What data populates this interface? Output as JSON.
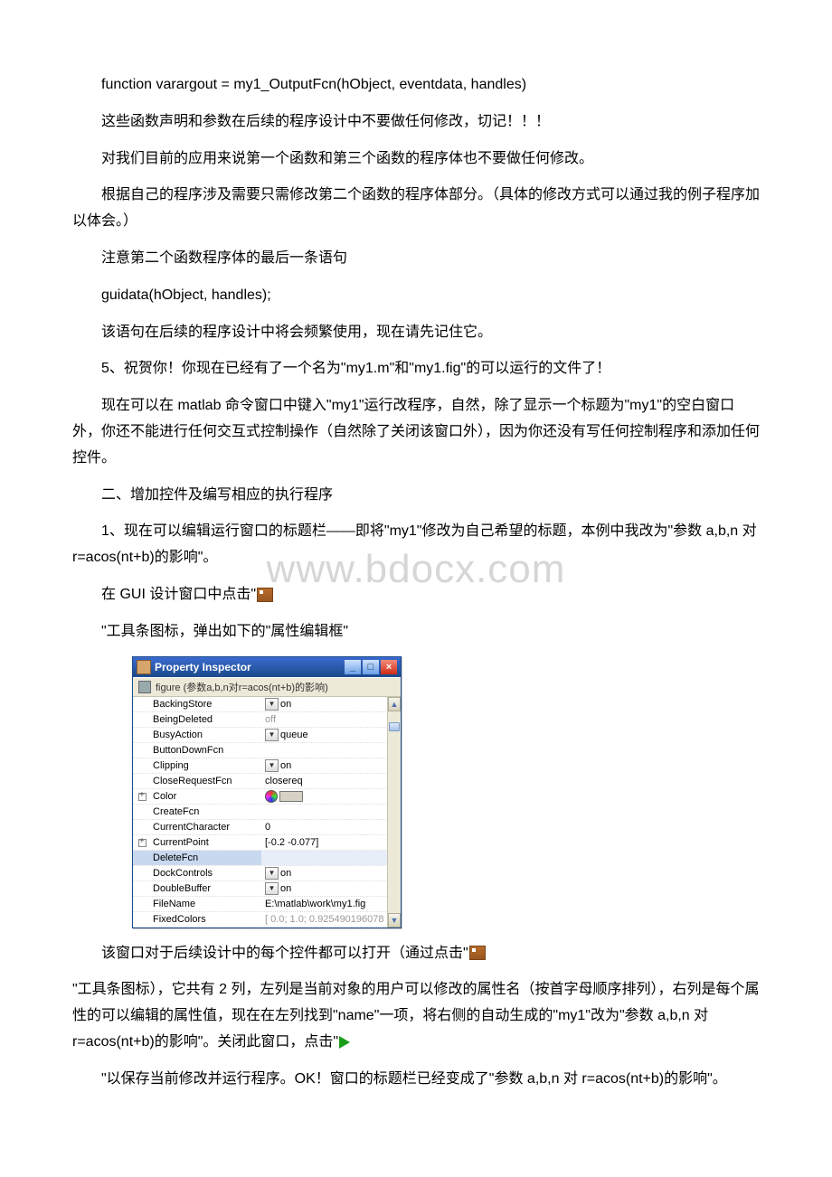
{
  "paragraphs": {
    "p1": "function varargout = my1_OutputFcn(hObject, eventdata, handles)",
    "p2": "这些函数声明和参数在后续的程序设计中不要做任何修改，切记！！！",
    "p3": "对我们目前的应用来说第一个函数和第三个函数的程序体也不要做任何修改。",
    "p4": "根据自己的程序涉及需要只需修改第二个函数的程序体部分。（具体的修改方式可以通过我的例子程序加以体会。）",
    "p5": "注意第二个函数程序体的最后一条语句",
    "p6": "guidata(hObject, handles);",
    "p7": "该语句在后续的程序设计中将会频繁使用，现在请先记住它。",
    "p8": "5、祝贺你！你现在已经有了一个名为\"my1.m\"和\"my1.fig\"的可以运行的文件了！",
    "p9": "现在可以在 matlab 命令窗口中键入\"my1\"运行改程序，自然，除了显示一个标题为\"my1\"的空白窗口外，你还不能进行任何交互式控制操作（自然除了关闭该窗口外），因为你还没有写任何控制程序和添加任何控件。",
    "p10": "二、增加控件及编写相应的执行程序",
    "p11": "1、现在可以编辑运行窗口的标题栏——即将\"my1\"修改为自己希望的标题，本例中我改为\"参数 a,b,n 对 r=acos(nt+b)的影响\"。",
    "p12": "在 GUI 设计窗口中点击\"",
    "p13": "\"工具条图标，弹出如下的\"属性编辑框\"",
    "p14": "该窗口对于后续设计中的每个控件都可以打开（通过点击\"",
    "p15": "\"工具条图标），它共有 2 列，左列是当前对象的用户可以修改的属性名（按首字母顺序排列），右列是每个属性的可以编辑的属性值，现在在左列找到\"name\"一项，将右侧的自动生成的\"my1\"改为\"参数 a,b,n 对 r=acos(nt+b)的影响\"。关闭此窗口，点击\"",
    "p16": "\"以保存当前修改并运行程序。OK！窗口的标题栏已经变成了\"参数 a,b,n 对 r=acos(nt+b)的影响\"。"
  },
  "watermark": "www.bdocx.com",
  "inspector": {
    "title": "Property Inspector",
    "subtitle": "figure (参数a,b,n对r=acos(nt+b)的影响)",
    "rows": [
      {
        "name": "BackingStore",
        "value": "on",
        "dd": true
      },
      {
        "name": "BeingDeleted",
        "value": "off",
        "dim": true
      },
      {
        "name": "BusyAction",
        "value": "queue",
        "dd": true
      },
      {
        "name": "ButtonDownFcn",
        "value": ""
      },
      {
        "name": "Clipping",
        "value": "on",
        "dd": true
      },
      {
        "name": "CloseRequestFcn",
        "value": "closereq"
      },
      {
        "name": "Color",
        "value": "",
        "color": true,
        "expand": true
      },
      {
        "name": "CreateFcn",
        "value": ""
      },
      {
        "name": "CurrentCharacter",
        "value": "0"
      },
      {
        "name": "CurrentPoint",
        "value": "[-0.2 -0.077]",
        "expand": true
      },
      {
        "name": "DeleteFcn",
        "value": "",
        "sel": true
      },
      {
        "name": "DockControls",
        "value": "on",
        "dd": true
      },
      {
        "name": "DoubleBuffer",
        "value": "on",
        "dd": true
      },
      {
        "name": "FileName",
        "value": "E:\\matlab\\work\\my1.fig"
      },
      {
        "name": "FixedColors",
        "value": "[ 0.0; 1.0; 0.925490196078",
        "dim": true
      }
    ]
  }
}
